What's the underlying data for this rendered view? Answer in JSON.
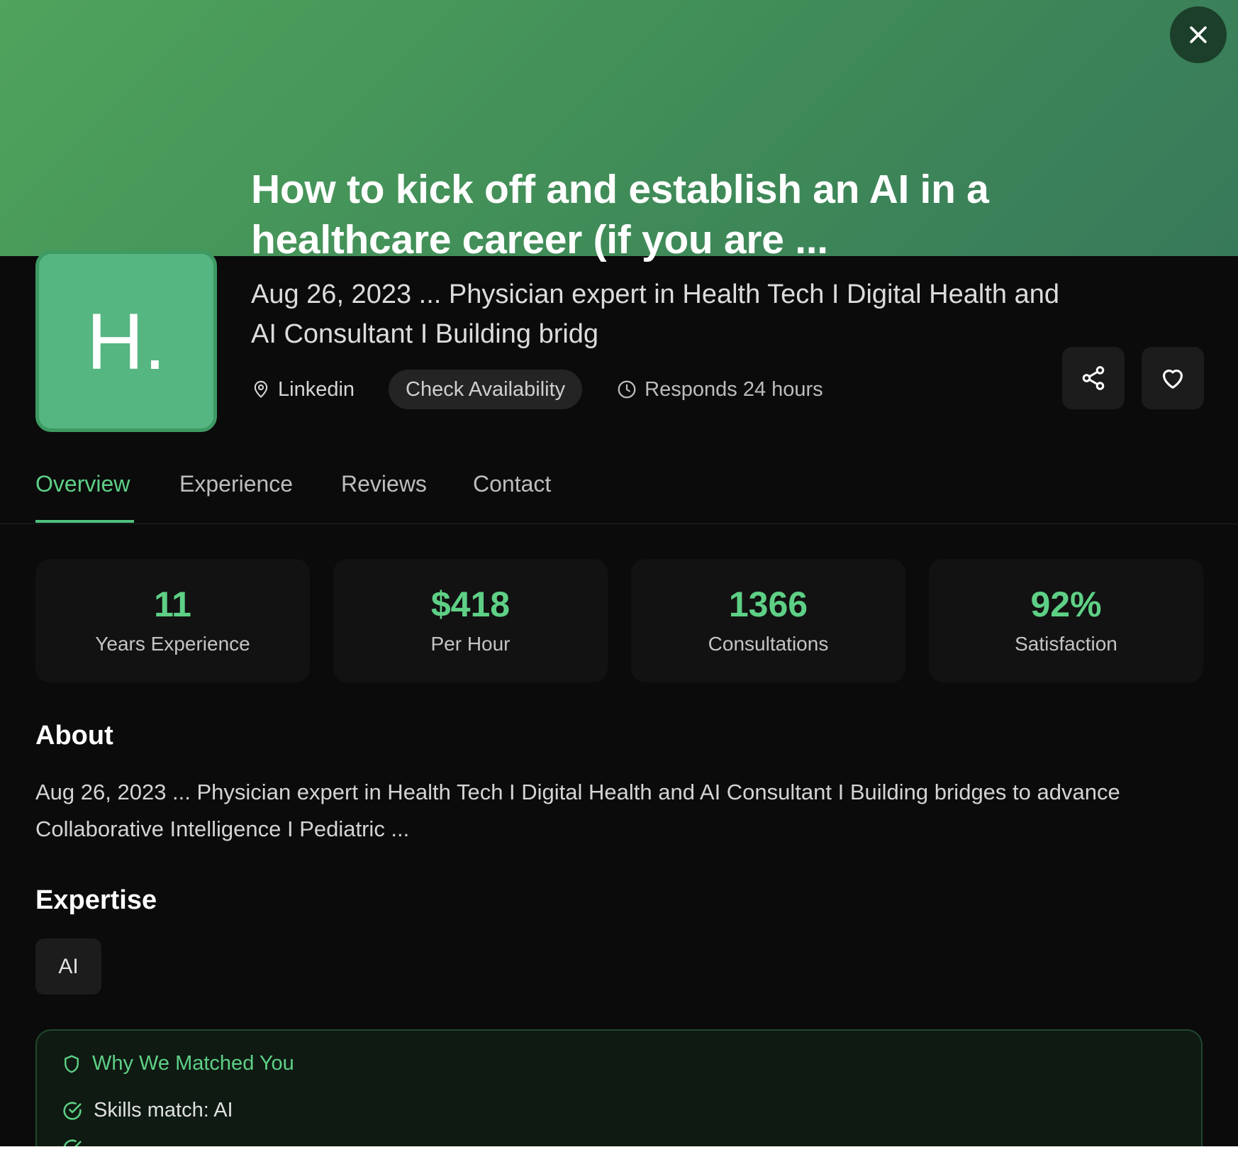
{
  "header": {
    "title": "How to kick off and establish an AI in a healthcare career (if you are ...",
    "close_icon": "close-icon"
  },
  "profile": {
    "avatar_text": "H.",
    "subtitle": "Aug 26, 2023 ... Physician expert in Health Tech I Digital Health and AI Consultant I Building bridg",
    "location": "Linkedin",
    "availability_button": "Check Availability",
    "responds": "Responds 24 hours"
  },
  "actions": {
    "share_icon": "share-icon",
    "favorite_icon": "heart-icon"
  },
  "tabs": [
    {
      "label": "Overview",
      "active": true
    },
    {
      "label": "Experience",
      "active": false
    },
    {
      "label": "Reviews",
      "active": false
    },
    {
      "label": "Contact",
      "active": false
    }
  ],
  "stats": [
    {
      "value": "11",
      "label": "Years Experience"
    },
    {
      "value": "$418",
      "label": "Per Hour"
    },
    {
      "value": "1366",
      "label": "Consultations"
    },
    {
      "value": "92%",
      "label": "Satisfaction"
    }
  ],
  "about": {
    "heading": "About",
    "text": "Aug 26, 2023 ... Physician expert in Health Tech I Digital Health and AI Consultant I Building bridges to advance Collaborative Intelligence I Pediatric ..."
  },
  "expertise": {
    "heading": "Expertise",
    "tags": [
      "AI"
    ]
  },
  "match": {
    "heading": "Why We Matched You",
    "items": [
      "Skills match: AI"
    ]
  },
  "colors": {
    "accent": "#5ed086",
    "banner": "#4fa35c",
    "background": "#0b0b0b"
  }
}
